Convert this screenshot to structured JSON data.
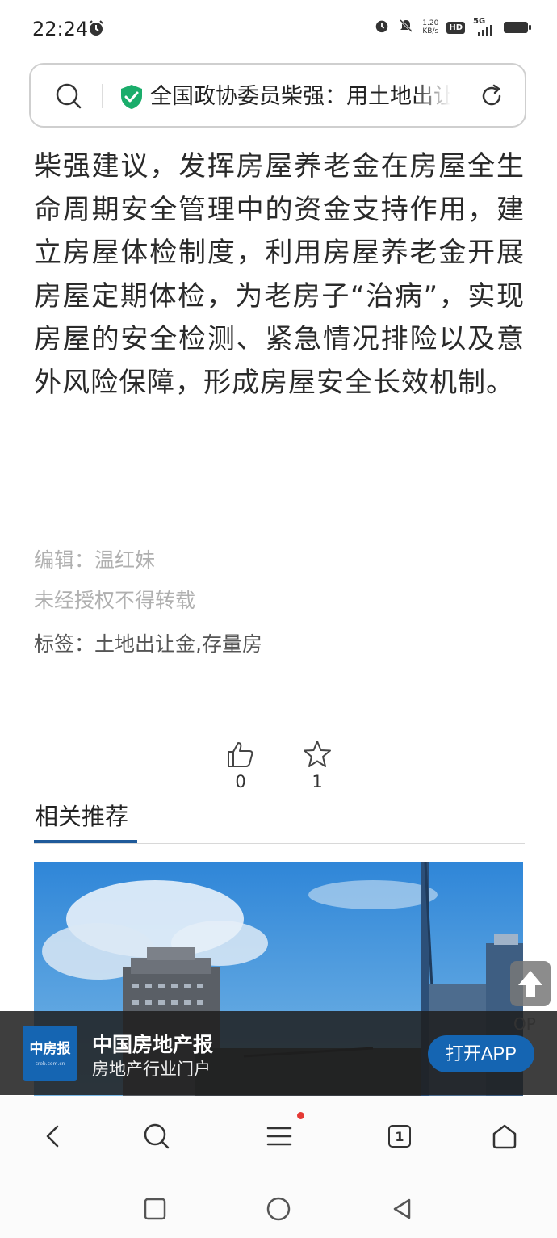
{
  "status_bar": {
    "time": "22:24",
    "net_speed_value": "1.20",
    "net_speed_unit": "KB/s",
    "hd_label": "HD",
    "network_label": "5G"
  },
  "url_bar": {
    "title": "全国政协委员柴强：用土地出让金"
  },
  "article": {
    "body": "柴强建议，发挥房屋养老金在房屋全生命周期安全管理中的资金支持作用，建立房屋体检制度，利用房屋养老金开展房屋定期体检，为老房子“治病”，实现房屋的安全检测、紧急情况排险以及意外风险保障，形成房屋安全长效机制。"
  },
  "meta": {
    "editor": "编辑：温红妹",
    "rights": "未经授权不得转载",
    "tags": "标签：土地出让金,存量房"
  },
  "reactions": {
    "likes": "0",
    "favorites": "1"
  },
  "related": {
    "title": "相关推荐"
  },
  "to_top": {
    "label": "OP"
  },
  "banner": {
    "logo_text": "中房报",
    "logo_sub": "creb.com.cn",
    "title": "中国房地产报",
    "subtitle": "房地产行业门户",
    "button": "打开APP"
  },
  "bottom_nav": {
    "tab_count": "1"
  },
  "colors": {
    "accent": "#1565b2",
    "tag_blue": "#1f5a9a",
    "shield_green": "#1aad6b",
    "badge_red": "#e53935"
  }
}
